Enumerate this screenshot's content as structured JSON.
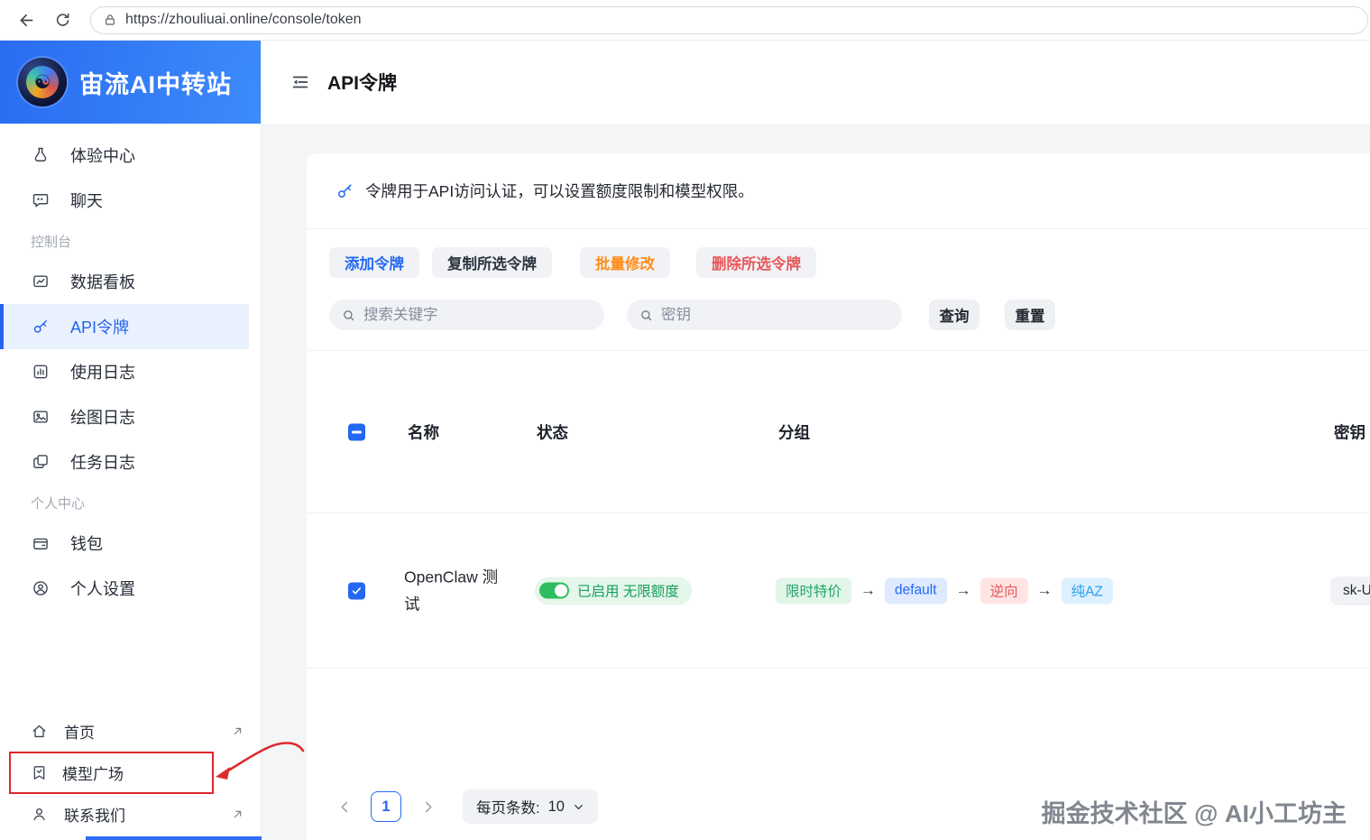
{
  "browser": {
    "url": "https://zhouliuai.online/console/token"
  },
  "sidebar": {
    "brand": "宙流AI中转站",
    "sections": [
      "控制台",
      "个人中心"
    ],
    "items": [
      {
        "label": "体验中心",
        "icon": "flask-icon"
      },
      {
        "label": "聊天",
        "icon": "chat-icon"
      },
      {
        "label": "数据看板",
        "icon": "dashboard-icon"
      },
      {
        "label": "API令牌",
        "icon": "key-icon",
        "active": true
      },
      {
        "label": "使用日志",
        "icon": "bar-chart-icon"
      },
      {
        "label": "绘图日志",
        "icon": "image-icon"
      },
      {
        "label": "任务日志",
        "icon": "copy-icon"
      },
      {
        "label": "钱包",
        "icon": "wallet-icon"
      },
      {
        "label": "个人设置",
        "icon": "user-settings-icon"
      }
    ],
    "footer": [
      {
        "label": "首页",
        "external": true
      },
      {
        "label": "模型广场",
        "annotated": true
      },
      {
        "label": "联系我们",
        "external": true
      }
    ]
  },
  "header": {
    "title": "API令牌"
  },
  "main": {
    "info": "令牌用于API访问认证，可以设置额度限制和模型权限。",
    "actions": [
      {
        "label": "添加令牌",
        "color": "#2468f2"
      },
      {
        "label": "复制所选令牌",
        "color": "#2b3440"
      },
      {
        "label": "批量修改",
        "color": "#ff8d1a"
      },
      {
        "label": "删除所选令牌",
        "color": "#e8575a"
      }
    ],
    "search": {
      "keyword_placeholder": "搜索关键字",
      "key_placeholder": "密钥",
      "query_label": "查询",
      "reset_label": "重置"
    },
    "table": {
      "headers": [
        "名称",
        "状态",
        "分组",
        "密钥"
      ],
      "group_separator": "→",
      "rows": [
        {
          "name": "OpenClaw 测试",
          "status": "已启用 无限额度",
          "enabled": true,
          "selected": true,
          "groups": [
            {
              "label": "限时特价",
              "type": "green"
            },
            {
              "label": "default",
              "type": "blue"
            },
            {
              "label": "逆向",
              "type": "red"
            },
            {
              "label": "纯AZ",
              "type": "lightblue"
            }
          ],
          "key": "sk-U"
        }
      ]
    },
    "pagination": {
      "current": "1",
      "page_size_label": "每页条数:",
      "page_size": "10"
    },
    "watermark": "掘金技术社区 @ AI小工坊主"
  },
  "colors": {
    "accent": "#2468f2",
    "success": "#17a05c",
    "warning": "#ff8d1a",
    "danger": "#e8575a",
    "brand_blue": "#2a6cf1",
    "annotation_red": "#e0262a"
  }
}
